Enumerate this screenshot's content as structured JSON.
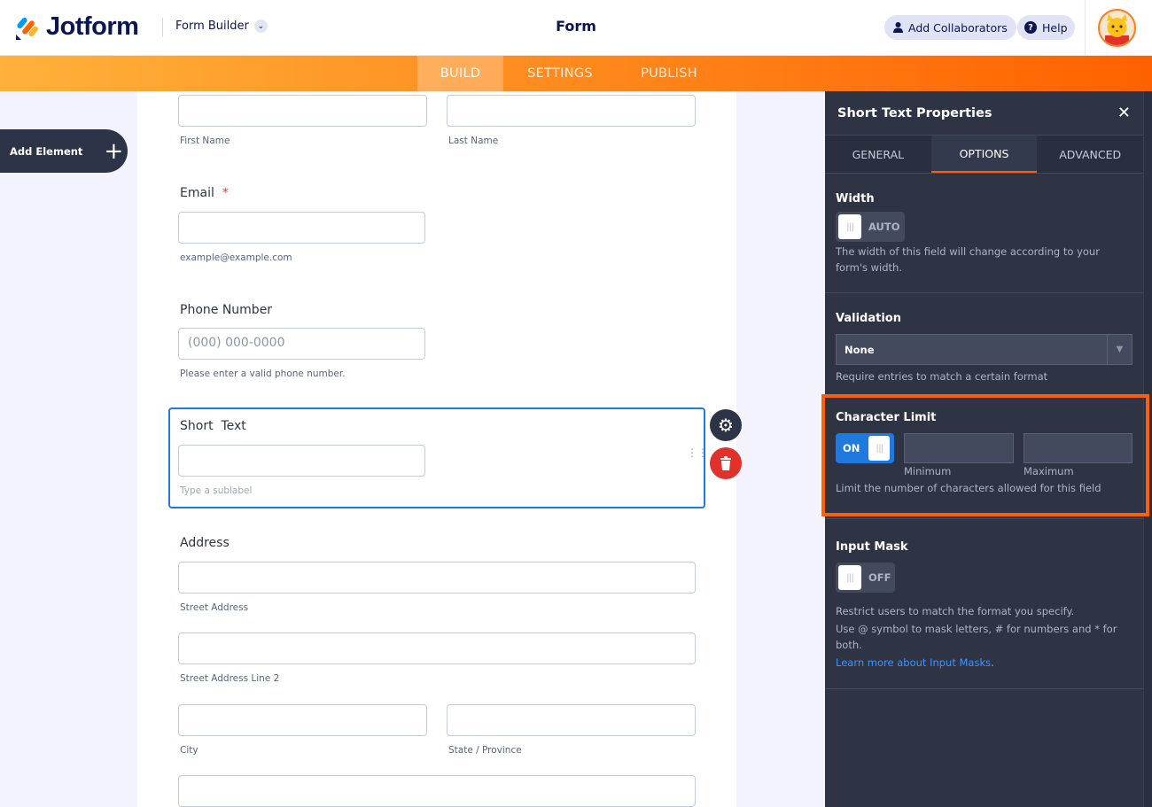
{
  "header": {
    "brand": "Jotform",
    "builder_label": "Form Builder",
    "title": "Form",
    "collab_label": "Add Collaborators",
    "help_label": "Help"
  },
  "tabs": [
    "BUILD",
    "SETTINGS",
    "PUBLISH"
  ],
  "add_element": "Add Element",
  "form": {
    "first_name": "First Name",
    "last_name": "Last Name",
    "email_label": "Email",
    "required_mark": "*",
    "email_sub": "example@example.com",
    "phone_label": "Phone Number",
    "phone_placeholder": "(000) 000-0000",
    "phone_sub": "Please enter a valid phone number.",
    "short_label": "Short  Text",
    "short_sub": "Type a sublabel",
    "address_label": "Address",
    "street": "Street Address",
    "street2": "Street Address Line 2",
    "city": "City",
    "state": "State / Province"
  },
  "panel": {
    "title": "Short Text Properties",
    "tabs": [
      "GENERAL",
      "OPTIONS",
      "ADVANCED"
    ],
    "width": {
      "title": "Width",
      "toggle": "AUTO",
      "desc": "The width of this field will change according to your form's width."
    },
    "validation": {
      "title": "Validation",
      "value": "None",
      "desc": "Require entries to match a certain format"
    },
    "char_limit": {
      "title": "Character Limit",
      "toggle": "ON",
      "min_label": "Minimum",
      "max_label": "Maximum",
      "desc": "Limit the number of characters allowed for this field"
    },
    "input_mask": {
      "title": "Input Mask",
      "toggle": "OFF",
      "desc1": "Restrict users to match the format you specify.",
      "desc2": "Use @ symbol to mask letters, # for numbers and * for both.",
      "link": "Learn more about Input Masks",
      "link_suffix": "."
    }
  },
  "colors": {
    "accent": "#ff6100",
    "blue": "#1f7ae0",
    "panel": "#2f3445"
  }
}
